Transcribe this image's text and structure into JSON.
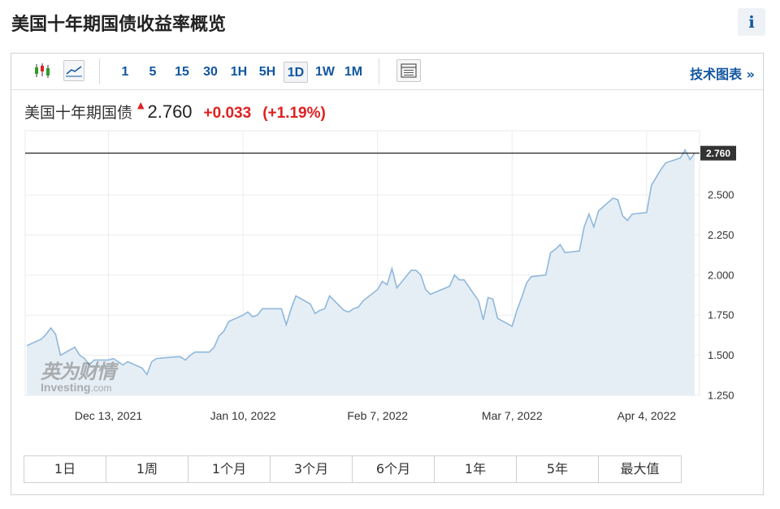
{
  "header": {
    "title": "美国十年期国债收益率概览",
    "info_label": "i"
  },
  "toolbar": {
    "timeframes": [
      "1",
      "5",
      "15",
      "30",
      "1H",
      "5H",
      "1D",
      "1W",
      "1M"
    ],
    "active_timeframe": "1D",
    "tech_link": "技术图表 »"
  },
  "quote": {
    "name": "美国十年期国债",
    "arrow": "▲",
    "last": "2.760",
    "change": "+0.033",
    "change_pct": "(+1.19%)",
    "up_color": "#e02020"
  },
  "watermark": {
    "cn": "英为财情",
    "en": "Investing",
    "en_suffix": ".com"
  },
  "ranges": [
    "1日",
    "1周",
    "1个月",
    "3个月",
    "6个月",
    "1年",
    "5年",
    "最大值"
  ],
  "chart_data": {
    "type": "area",
    "series": [
      {
        "x": [
          "2021-11-26",
          "2021-11-29",
          "2021-11-30",
          "2021-12-01",
          "2021-12-02",
          "2021-12-03",
          "2021-12-06",
          "2021-12-07",
          "2021-12-08",
          "2021-12-09",
          "2021-12-10",
          "2021-12-13",
          "2021-12-14",
          "2021-12-15",
          "2021-12-16",
          "2021-12-17",
          "2021-12-20",
          "2021-12-21",
          "2021-12-22",
          "2021-12-23",
          "2021-12-27",
          "2021-12-28",
          "2021-12-29",
          "2021-12-30",
          "2021-12-31",
          "2022-01-03",
          "2022-01-04",
          "2022-01-05",
          "2022-01-06",
          "2022-01-07",
          "2022-01-10",
          "2022-01-11",
          "2022-01-12",
          "2022-01-13",
          "2022-01-14",
          "2022-01-18",
          "2022-01-19",
          "2022-01-20",
          "2022-01-21",
          "2022-01-24",
          "2022-01-25",
          "2022-01-26",
          "2022-01-27",
          "2022-01-28",
          "2022-01-31",
          "2022-02-01",
          "2022-02-02",
          "2022-02-03",
          "2022-02-04",
          "2022-02-07",
          "2022-02-08",
          "2022-02-09",
          "2022-02-10",
          "2022-02-11",
          "2022-02-14",
          "2022-02-15",
          "2022-02-16",
          "2022-02-17",
          "2022-02-18",
          "2022-02-22",
          "2022-02-23",
          "2022-02-24",
          "2022-02-25",
          "2022-02-28",
          "2022-03-01",
          "2022-03-02",
          "2022-03-03",
          "2022-03-04",
          "2022-03-07",
          "2022-03-08",
          "2022-03-09",
          "2022-03-10",
          "2022-03-11",
          "2022-03-14",
          "2022-03-15",
          "2022-03-16",
          "2022-03-17",
          "2022-03-18",
          "2022-03-21",
          "2022-03-22",
          "2022-03-23",
          "2022-03-24",
          "2022-03-25",
          "2022-03-28",
          "2022-03-29",
          "2022-03-30",
          "2022-03-31",
          "2022-04-01",
          "2022-04-04",
          "2022-04-05",
          "2022-04-06",
          "2022-04-07",
          "2022-04-08",
          "2022-04-11",
          "2022-04-12",
          "2022-04-13",
          "2022-04-14"
        ],
        "values": [
          1.56,
          1.6,
          1.63,
          1.67,
          1.63,
          1.5,
          1.55,
          1.5,
          1.48,
          1.44,
          1.47,
          1.47,
          1.48,
          1.46,
          1.44,
          1.46,
          1.42,
          1.38,
          1.46,
          1.48,
          1.49,
          1.49,
          1.47,
          1.5,
          1.52,
          1.52,
          1.55,
          1.62,
          1.65,
          1.71,
          1.75,
          1.77,
          1.74,
          1.75,
          1.79,
          1.79,
          1.69,
          1.79,
          1.87,
          1.82,
          1.76,
          1.78,
          1.79,
          1.87,
          1.78,
          1.77,
          1.79,
          1.8,
          1.84,
          1.91,
          1.96,
          1.94,
          2.04,
          1.92,
          2.03,
          2.03,
          2.0,
          1.91,
          1.88,
          1.93,
          2.0,
          1.97,
          1.97,
          1.84,
          1.72,
          1.86,
          1.85,
          1.73,
          1.68,
          1.78,
          1.86,
          1.95,
          1.99,
          2.0,
          2.14,
          2.16,
          2.19,
          2.14,
          2.15,
          2.3,
          2.38,
          2.3,
          2.4,
          2.48,
          2.47,
          2.37,
          2.34,
          2.38,
          2.39,
          2.56,
          2.61,
          2.66,
          2.7,
          2.73,
          2.78,
          2.72,
          2.76
        ]
      }
    ],
    "last_value_label": "2.760",
    "x_tick_labels": [
      {
        "x": "2021-12-13",
        "label": "Dec 13, 2021"
      },
      {
        "x": "2022-01-10",
        "label": "Jan 10, 2022"
      },
      {
        "x": "2022-02-07",
        "label": "Feb 7, 2022"
      },
      {
        "x": "2022-03-07",
        "label": "Mar 7, 2022"
      },
      {
        "x": "2022-04-04",
        "label": "Apr 4, 2022"
      }
    ],
    "y_ticks": [
      1.25,
      1.5,
      1.75,
      2.0,
      2.25,
      2.5
    ],
    "y_tick_labels": [
      "1.250",
      "1.500",
      "1.750",
      "2.000",
      "2.250",
      "2.500"
    ],
    "ylim": [
      1.25,
      2.9
    ],
    "colors": {
      "line": "#8fb8dc",
      "fill": "#e6eef5",
      "ref_line": "#222222",
      "label_bg": "#333333"
    },
    "grid": true
  }
}
